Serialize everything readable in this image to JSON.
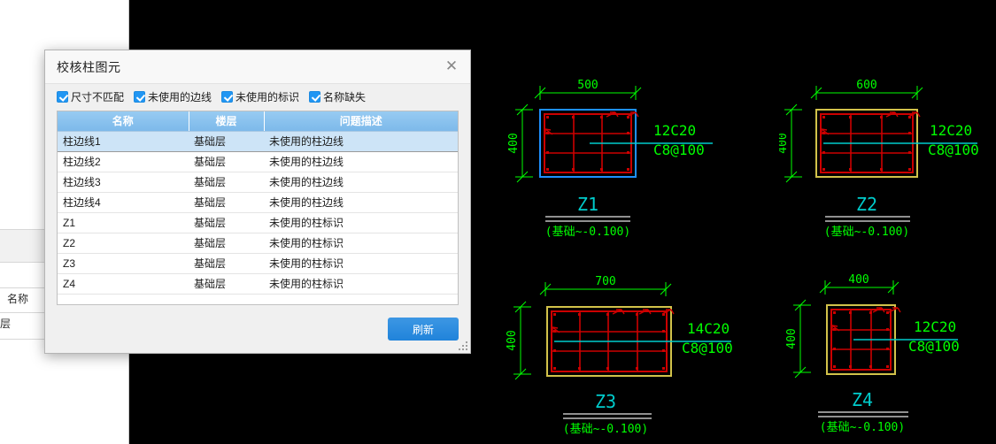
{
  "app": {
    "canvas_background": "#000000",
    "panel_background": "#ffffff"
  },
  "left_panel": {
    "visible_fragments": [
      {
        "text": "名称"
      },
      {
        "text": "层"
      }
    ]
  },
  "dialog": {
    "title": "校核柱图元",
    "close_icon": "close-icon",
    "filters": [
      {
        "label": "尺寸不匹配",
        "checked": true
      },
      {
        "label": "未使用的边线",
        "checked": true
      },
      {
        "label": "未使用的标识",
        "checked": true
      },
      {
        "label": "名称缺失",
        "checked": true
      }
    ],
    "table": {
      "columns": [
        "名称",
        "楼层",
        "问题描述"
      ],
      "rows": [
        {
          "name": "柱边线1",
          "floor": "基础层",
          "issue": "未使用的柱边线",
          "selected": true
        },
        {
          "name": "柱边线2",
          "floor": "基础层",
          "issue": "未使用的柱边线",
          "selected": false
        },
        {
          "name": "柱边线3",
          "floor": "基础层",
          "issue": "未使用的柱边线",
          "selected": false
        },
        {
          "name": "柱边线4",
          "floor": "基础层",
          "issue": "未使用的柱边线",
          "selected": false
        },
        {
          "name": "Z1",
          "floor": "基础层",
          "issue": "未使用的柱标识",
          "selected": false
        },
        {
          "name": "Z2",
          "floor": "基础层",
          "issue": "未使用的柱标识",
          "selected": false
        },
        {
          "name": "Z3",
          "floor": "基础层",
          "issue": "未使用的柱标识",
          "selected": false
        },
        {
          "name": "Z4",
          "floor": "基础层",
          "issue": "未使用的柱标识",
          "selected": false
        }
      ]
    },
    "refresh_label": "刷新",
    "accent_color": "#2c8ce0",
    "header_color": "#89c2ef"
  },
  "drawing": {
    "colors": {
      "dimension": "#00ff00",
      "rebar": "#cc0000",
      "outline_selected": "#1e90ff",
      "outline_normal": "#d2c24a",
      "leader": "#00cccc",
      "tag": "#00cccc",
      "grade_line": "#c0c0c0"
    },
    "columns": [
      {
        "tag": "Z1",
        "width_label": "500",
        "height_label": "400",
        "rebar_main": "12C20",
        "rebar_stirrup": "C8@100",
        "elevation": "(基础~-0.100)",
        "outline": "selected",
        "cols": 3,
        "rows": 3
      },
      {
        "tag": "Z2",
        "width_label": "600",
        "height_label": "400",
        "rebar_main": "12C20",
        "rebar_stirrup": "C8@100",
        "elevation": "(基础~-0.100)",
        "outline": "normal",
        "cols": 3,
        "rows": 3
      },
      {
        "tag": "Z3",
        "width_label": "700",
        "height_label": "400",
        "rebar_main": "14C20",
        "rebar_stirrup": "C8@100",
        "elevation": "(基础~-0.100)",
        "outline": "normal",
        "cols": 4,
        "rows": 3
      },
      {
        "tag": "Z4",
        "width_label": "400",
        "height_label": "400",
        "rebar_main": "12C20",
        "rebar_stirrup": "C8@100",
        "elevation": "(基础~-0.100)",
        "outline": "normal",
        "cols": 3,
        "rows": 3
      }
    ]
  }
}
